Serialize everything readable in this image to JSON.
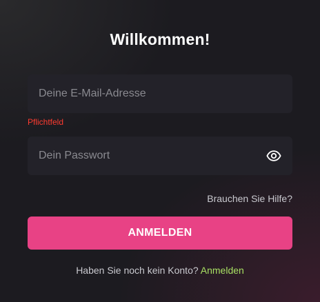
{
  "title": "Willkommen!",
  "email": {
    "placeholder": "Deine E-Mail-Adresse",
    "value": "",
    "error": "Pflichtfeld"
  },
  "password": {
    "placeholder": "Dein Passwort",
    "value": "",
    "toggle_icon": "eye-icon"
  },
  "help_link": "Brauchen Sie Hilfe?",
  "login_button": "ANMELDEN",
  "signup": {
    "prompt": "Haben Sie noch kein Konto?",
    "link": "Anmelden"
  },
  "colors": {
    "accent": "#e84285",
    "error": "#ff3b30",
    "link_green": "#a8e063",
    "field_bg": "#232229"
  }
}
